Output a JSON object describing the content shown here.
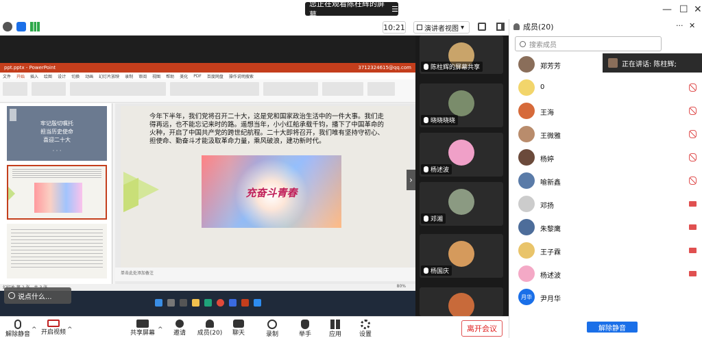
{
  "top": {
    "banner_text": "您正在观看陈柱辉的屏幕",
    "banner_menu": "☰"
  },
  "toolbar": {
    "clock": "10:21",
    "view_mode": "演讲者视图",
    "view_caret": "▾"
  },
  "ppt": {
    "titlebar_file": "ppt.pptx - PowerPoint",
    "titlebar_user": "3712324615@qq.com",
    "tabs": [
      "文件",
      "开始",
      "插入",
      "绘图",
      "设计",
      "切换",
      "动画",
      "幻灯片放映",
      "录制",
      "审阅",
      "视图",
      "帮助",
      "美化",
      "PDF",
      "百度网盘",
      "操作说明搜索"
    ],
    "slide_text": "今年下半年，我们党将召开二十大，这是党和国家政治生活中的一件大事。我们走得再远，也不能忘记来时的路。遥想当年，小小红船承载千钧，播下了中国革命的火种，开启了中国共产党的跨世纪航程。二十大即将召开，我们唯有坚持守初心、担使命、勤奋斗才能汲取革命力量，乘风破浪，建功新时代。",
    "slide_image_title": "充奋斗青春",
    "thumb1_lines": [
      "牢记殷切嘱托",
      "担当历史使命",
      "喜迎二十大"
    ],
    "thumb1_dots": "· · ·",
    "notes": "单击此处添加备注",
    "status": "幻灯片 第 2 张，共 3 张",
    "zoom": "80%",
    "say_text": "说点什么..."
  },
  "video_tiles": [
    {
      "name": "陈柱辉的屏幕共享",
      "color": "#c9a46a"
    },
    {
      "name": "晓晓晓晓",
      "color": "#7a8c6b"
    },
    {
      "name": "杨述波",
      "color": "#f0a0c8"
    },
    {
      "name": "邓湘",
      "color": "#8b9a82"
    },
    {
      "name": "杨国庆",
      "color": "#d59a5c"
    }
  ],
  "panel": {
    "title": "成员(20)",
    "more": "···",
    "close": "✕",
    "search_placeholder": "搜索成员",
    "speaking": "正在讲话: 陈柱辉;",
    "unmute": "解除静音",
    "members": [
      {
        "name": "郑芳芳",
        "color": "#8a6e5a",
        "mic": "none"
      },
      {
        "name": "0",
        "color": "#f2d56b",
        "mic": "muted"
      },
      {
        "name": "王海",
        "color": "#d66a3a",
        "mic": "muted"
      },
      {
        "name": "王微雅",
        "color": "#b98c6c",
        "mic": "muted"
      },
      {
        "name": "杨婷",
        "color": "#6b4a3b",
        "mic": "muted"
      },
      {
        "name": "喻新鑫",
        "color": "#5a7ba8",
        "mic": "muted"
      },
      {
        "name": "邓扬",
        "color": "#cccccc",
        "mic": "video-off"
      },
      {
        "name": "朱黎鹰",
        "color": "#4d6d9a",
        "mic": "video-off"
      },
      {
        "name": "王子霖",
        "color": "#e9c46a",
        "mic": "video-off"
      },
      {
        "name": "杨述波",
        "color": "#f4a9c6",
        "mic": "video-off"
      },
      {
        "name": "尹月华",
        "color": "#1a6fe8",
        "mic": "none",
        "initials": "月华"
      }
    ]
  },
  "bottom": {
    "mute": "解除静音",
    "video": "开启视频",
    "share": "共享屏幕",
    "invite": "邀请",
    "members": "成员(20)",
    "chat": "聊天",
    "record": "录制",
    "raise": "举手",
    "apps": "应用",
    "settings": "设置",
    "leave": "离开会议"
  },
  "colors": {
    "accent": "#1a6fe8",
    "leave": "#e02020",
    "ppt_red": "#c43e1c"
  }
}
